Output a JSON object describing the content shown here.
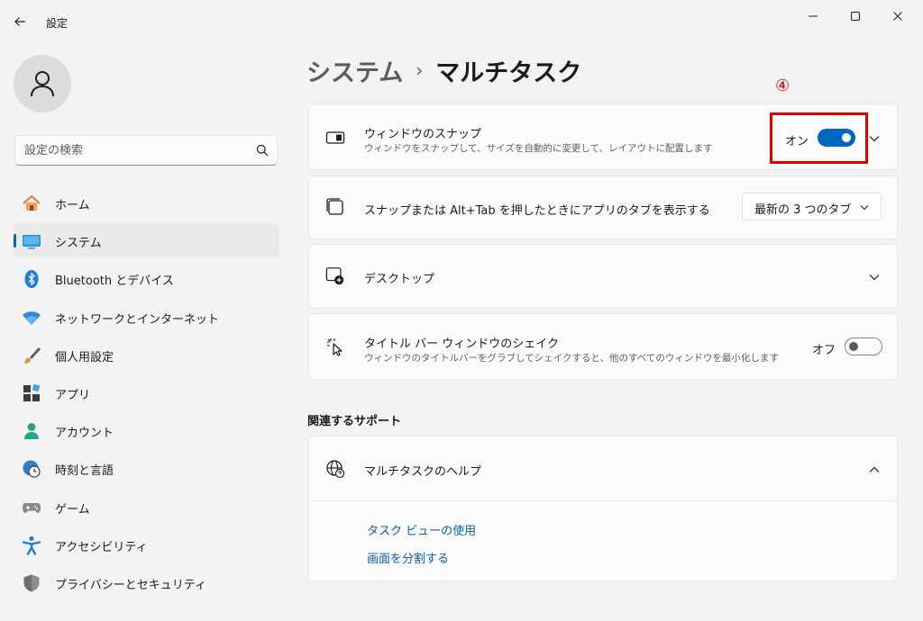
{
  "app": {
    "title": "設定"
  },
  "user": {
    "avatar_icon": "person-icon"
  },
  "search": {
    "placeholder": "設定の検索"
  },
  "nav": {
    "items": [
      {
        "label": "ホーム",
        "icon": "home-icon",
        "active": false
      },
      {
        "label": "システム",
        "icon": "display-icon",
        "active": true
      },
      {
        "label": "Bluetooth とデバイス",
        "icon": "bluetooth-icon",
        "active": false
      },
      {
        "label": "ネットワークとインターネット",
        "icon": "wifi-icon",
        "active": false
      },
      {
        "label": "個人用設定",
        "icon": "brush-icon",
        "active": false
      },
      {
        "label": "アプリ",
        "icon": "apps-icon",
        "active": false
      },
      {
        "label": "アカウント",
        "icon": "account-icon",
        "active": false
      },
      {
        "label": "時刻と言語",
        "icon": "clock-globe-icon",
        "active": false
      },
      {
        "label": "ゲーム",
        "icon": "gamepad-icon",
        "active": false
      },
      {
        "label": "アクセシビリティ",
        "icon": "accessibility-icon",
        "active": false
      },
      {
        "label": "プライバシーとセキュリティ",
        "icon": "shield-icon",
        "active": false
      }
    ]
  },
  "breadcrumb": {
    "parent": "システム",
    "separator": "›",
    "current": "マルチタスク"
  },
  "settings": {
    "snap": {
      "title": "ウィンドウのスナップ",
      "description": "ウィンドウをスナップして、サイズを自動的に変更して、レイアウトに配置します",
      "state_label": "オン",
      "on": true
    },
    "snap_tabs": {
      "title": "スナップまたは Alt+Tab を押したときにアプリのタブを表示する",
      "selected": "最新の 3 つのタブ"
    },
    "desktops": {
      "title": "デスクトップ"
    },
    "shake": {
      "title": "タイトル バー ウィンドウのシェイク",
      "description": "ウィンドウのタイトルバーをグラブしてシェイクすると、他のすべてのウィンドウを最小化します",
      "state_label": "オフ",
      "on": false
    }
  },
  "annotation": {
    "step": "④",
    "color": "#e00000"
  },
  "support": {
    "section_title": "関連するサポート",
    "help_title": "マルチタスクのヘルプ",
    "links": [
      "タスク ビューの使用",
      "画面を分割する"
    ]
  },
  "colors": {
    "accent": "#0067c0",
    "link": "#0b5cad"
  }
}
